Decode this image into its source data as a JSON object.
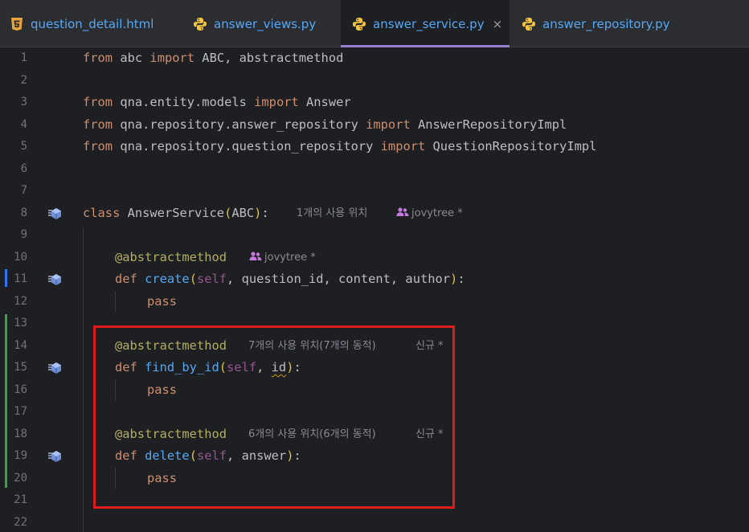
{
  "tabs": [
    {
      "label": "question_detail.html",
      "icon": "html5-icon",
      "active": false
    },
    {
      "label": "answer_views.py",
      "icon": "python-icon",
      "active": false
    },
    {
      "label": "answer_service.py",
      "icon": "python-icon",
      "active": true,
      "close": "×"
    },
    {
      "label": "answer_repository.py",
      "icon": "python-icon",
      "active": false
    }
  ],
  "colors": {
    "keyword": "#cf8e6d",
    "function": "#56a8f5",
    "decorator": "#b3ae60",
    "self": "#94558d",
    "text": "#bcbec4",
    "hint": "#868a91",
    "highlight": "#e01b1b",
    "active_tab_underline": "#9a7fd1",
    "vcs_modified": "#3574f0",
    "vcs_added": "#549159"
  },
  "line_numbers": [
    "1",
    "2",
    "3",
    "4",
    "5",
    "6",
    "7",
    "8",
    "9",
    "10",
    "11",
    "12",
    "13",
    "14",
    "15",
    "16",
    "17",
    "18",
    "19",
    "20",
    "21",
    "22"
  ],
  "lines": {
    "l1": {
      "a": "from",
      "b": " abc ",
      "c": "import",
      "d": " ABC, abstractmethod"
    },
    "l3": {
      "a": "from",
      "b": " qna.entity.models ",
      "c": "import",
      "d": " Answer"
    },
    "l4": {
      "a": "from",
      "b": " qna.repository.answer_repository ",
      "c": "import",
      "d": " AnswerRepositoryImpl"
    },
    "l5": {
      "a": "from",
      "b": " qna.repository.question_repository ",
      "c": "import",
      "d": " QuestionRepositoryImpl"
    },
    "l8": {
      "kw": "class",
      "name": " AnswerService",
      "p1": "(",
      "base": "ABC",
      "p2": ")",
      "colon": ":"
    },
    "l10": {
      "deco": "@abstractmethod"
    },
    "l11": {
      "kw": "def",
      "fn": " create",
      "p1": "(",
      "self": "self",
      "rest": ", question_id, content, author",
      "p2": ")",
      "colon": ":"
    },
    "l12": {
      "kw": "pass"
    },
    "l14": {
      "deco": "@abstractmethod"
    },
    "l15": {
      "kw": "def",
      "fn": " find_by_id",
      "p1": "(",
      "self": "self",
      "sep": ", ",
      "param": "id",
      "p2": ")",
      "colon": ":"
    },
    "l16": {
      "kw": "pass"
    },
    "l18": {
      "deco": "@abstractmethod"
    },
    "l19": {
      "kw": "def",
      "fn": " delete",
      "p1": "(",
      "self": "self",
      "rest": ", answer",
      "p2": ")",
      "colon": ":"
    },
    "l20": {
      "kw": "pass"
    }
  },
  "hints": {
    "l8_usages": "1개의 사용 위치",
    "l8_author": "jovytree *",
    "l10_author": "jovytree *",
    "l14_usages": "7개의 사용 위치(7개의 동적)",
    "l14_new": "신규 *",
    "l18_usages": "6개의 사용 위치(6개의 동적)",
    "l18_new": "신규 *"
  }
}
